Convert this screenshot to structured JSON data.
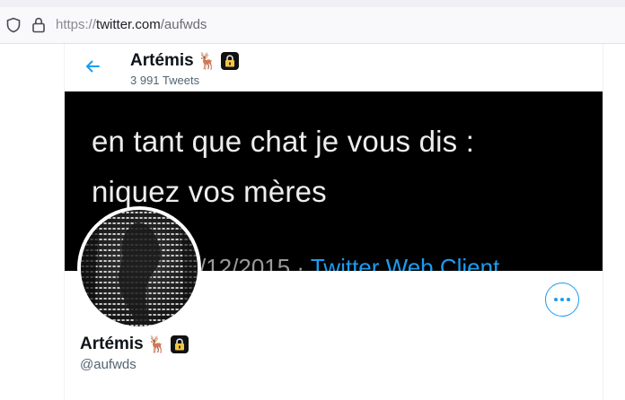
{
  "browser": {
    "url_proto": "https://",
    "url_host": "twitter.com",
    "url_path": "/aufwds"
  },
  "header": {
    "name": "Artémis",
    "deer_emoji": "🦌",
    "lock_icon": "lock-icon",
    "tweet_count": "3 991 Tweets"
  },
  "banner": {
    "line1": "en tant que chat je vous dis :",
    "line2": "niquez vos mères",
    "date": "/12/2015 · ",
    "client": "Twitter Web Client"
  },
  "profile": {
    "name": "Artémis",
    "deer_emoji": "🦌",
    "handle": "@aufwds"
  },
  "colors": {
    "accent": "#1d9bf0",
    "text": "#0f1419",
    "secondary": "#536471"
  }
}
